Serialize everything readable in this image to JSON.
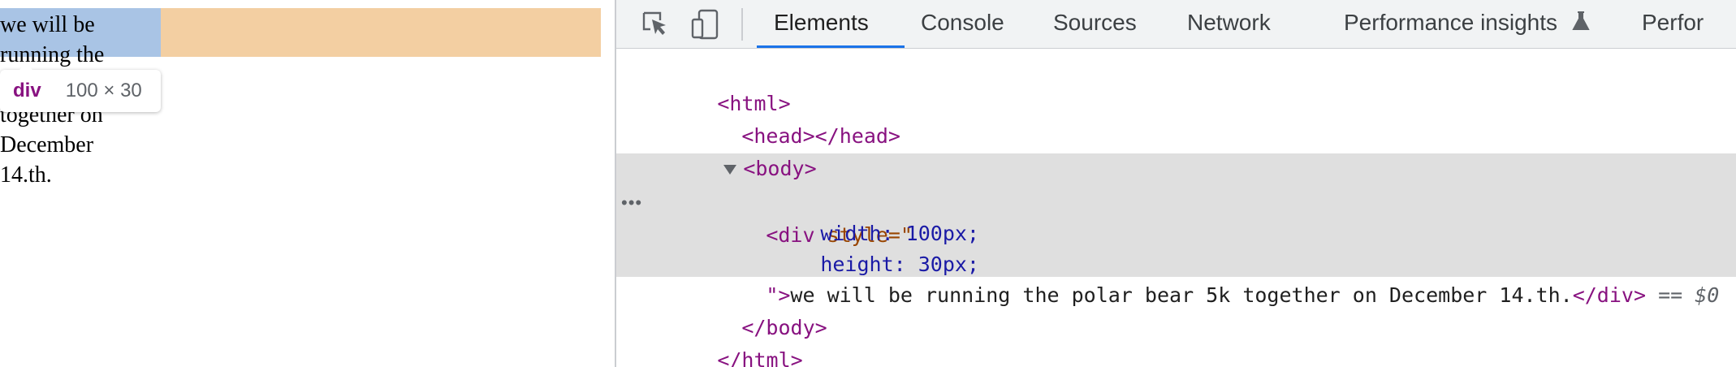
{
  "preview": {
    "text": "we will be running the polar bear 5k together on December 14.th.",
    "tooltip": {
      "tag": "div",
      "dims": "100 × 30"
    }
  },
  "devtools": {
    "tabs": [
      "Elements",
      "Console",
      "Sources",
      "Network",
      "Performance insights",
      "Perfor"
    ],
    "active_tab": "Elements",
    "tree": {
      "html_open": "<html>",
      "head": "<head></head>",
      "body_open": "<body>",
      "div_open": "<div",
      "style_attr": "style=\"",
      "css_width": "width: 100px;",
      "css_height": "height: 30px;",
      "close_quote": "\">",
      "div_text": "we will be running the polar bear 5k together on December 14.th.",
      "div_close": "</div>",
      "eq": "==",
      "ref": "$0",
      "body_close": "</body>",
      "html_close": "</html>",
      "ellipsis": "•••"
    }
  }
}
